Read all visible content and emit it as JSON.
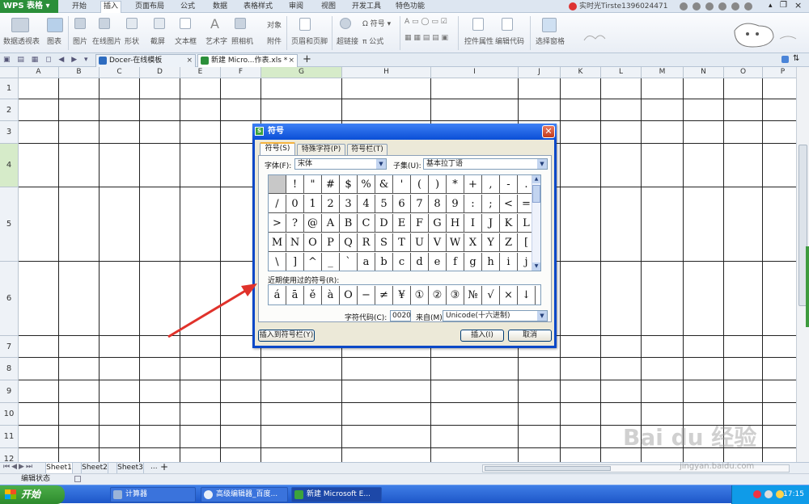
{
  "app": {
    "brand": "WPS 表格",
    "brand_color": "#2b8f3a"
  },
  "menu_tabs": [
    "开始",
    "插入",
    "页面布局",
    "公式",
    "数据",
    "表格样式",
    "审阅",
    "视图",
    "开发工具",
    "特色功能"
  ],
  "active_menu": "插入",
  "user": {
    "name": "实时光Tirste1396024471"
  },
  "ribbon": [
    {
      "label": "数据透视表"
    },
    {
      "label": "图表"
    },
    {
      "label": "图片"
    },
    {
      "label": "在线图片"
    },
    {
      "label": "形状"
    },
    {
      "label": "截屏"
    },
    {
      "label": "文本框"
    },
    {
      "label": "艺术字"
    },
    {
      "label": "照相机"
    },
    {
      "label": "对象"
    },
    {
      "label": "附件"
    },
    {
      "label": "页眉和页脚"
    },
    {
      "label": "超链接"
    },
    {
      "label": "符号"
    },
    {
      "label": "公式"
    },
    {
      "label": "控件属性"
    },
    {
      "label": "编辑代码"
    },
    {
      "label": "选择窗格"
    }
  ],
  "doc_tabs": [
    {
      "label": "Docer-在线模板",
      "active": false
    },
    {
      "label": "新建 Micro...作表.xls *",
      "active": true
    }
  ],
  "columns": [
    "A",
    "B",
    "C",
    "D",
    "E",
    "F",
    "G",
    "H",
    "I",
    "J",
    "K",
    "L",
    "M",
    "N",
    "O",
    "P"
  ],
  "selected_column": "G",
  "rows": [
    "1",
    "2",
    "3",
    "4",
    "5",
    "6",
    "7",
    "8",
    "9",
    "10",
    "11",
    "12"
  ],
  "selected_row": "4",
  "sheets": [
    "Sheet1",
    "Sheet2",
    "Sheet3",
    "...",
    "+"
  ],
  "active_sheet": "Sheet1",
  "status": {
    "mode": "编辑状态"
  },
  "taskbar": {
    "start": "开始",
    "tasks": [
      {
        "label": "计算器",
        "active": false
      },
      {
        "label": "高级编辑器_百度...",
        "active": false
      },
      {
        "label": "新建 Microsoft E...",
        "active": true
      }
    ],
    "clock": "17:15"
  },
  "dialog": {
    "title": "符号",
    "tabs": [
      "符号(S)",
      "特殊字符(P)",
      "符号栏(T)"
    ],
    "active_tab": "符号(S)",
    "font_label": "字体(F):",
    "font_value": "宋体",
    "subset_label": "子集(U):",
    "subset_value": "基本拉丁语",
    "symbols": [
      [
        " ",
        "!",
        "\"",
        "#",
        "$",
        "%",
        "&",
        "'",
        "(",
        ")",
        "*",
        "+",
        ",",
        "-",
        "."
      ],
      [
        "/",
        "0",
        "1",
        "2",
        "3",
        "4",
        "5",
        "6",
        "7",
        "8",
        "9",
        ":",
        ";",
        "<",
        "="
      ],
      [
        ">",
        "?",
        "@",
        "A",
        "B",
        "C",
        "D",
        "E",
        "F",
        "G",
        "H",
        "I",
        "J",
        "K",
        "L"
      ],
      [
        "M",
        "N",
        "O",
        "P",
        "Q",
        "R",
        "S",
        "T",
        "U",
        "V",
        "W",
        "X",
        "Y",
        "Z",
        "["
      ],
      [
        "\\",
        "]",
        "^",
        "_",
        "`",
        "a",
        "b",
        "c",
        "d",
        "e",
        "f",
        "g",
        "h",
        "i",
        "j"
      ]
    ],
    "recent_label": "近期使用过的符号(R):",
    "recent": [
      "á",
      "ā",
      "ě",
      "à",
      "O",
      "−",
      "≠",
      "¥",
      "①",
      "②",
      "③",
      "№",
      "√",
      "×",
      "↓"
    ],
    "charcode_label": "字符代码(C):",
    "charcode_value": "0020",
    "from_label": "来自(M)",
    "from_value": "Unicode(十六进制)",
    "insert_to_bar": "插入到符号栏(Y)",
    "insert": "插入(I)",
    "cancel": "取消"
  },
  "watermark": {
    "text": "Bai du 经验",
    "sub": "jingyan.baidu.com"
  }
}
